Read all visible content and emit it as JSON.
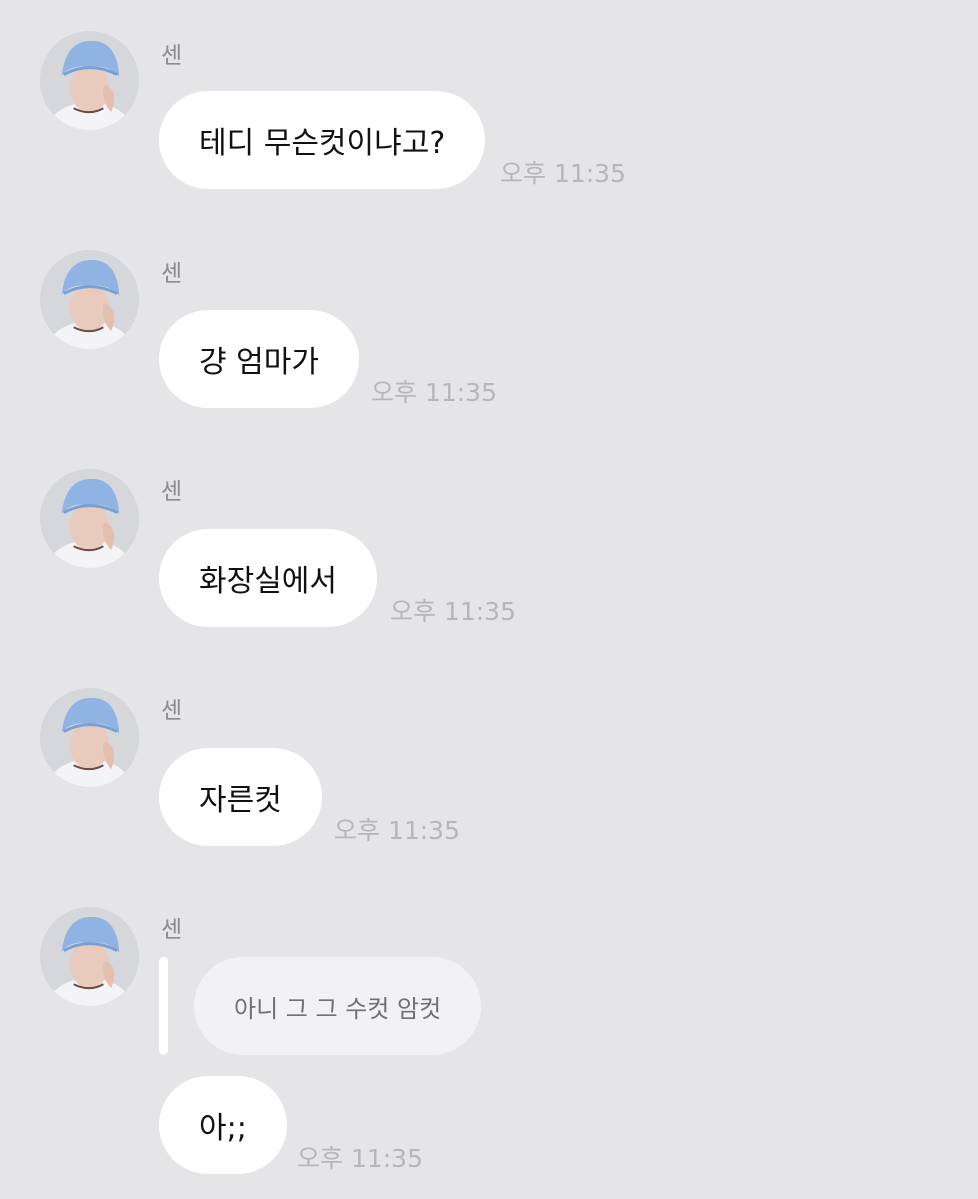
{
  "messages": [
    {
      "sender": "센",
      "text": "테디 무슨컷이냐고?",
      "time": "오후 11:35"
    },
    {
      "sender": "센",
      "text": "걍 엄마가",
      "time": "오후 11:35"
    },
    {
      "sender": "센",
      "text": "화장실에서",
      "time": "오후 11:35"
    },
    {
      "sender": "센",
      "text": "자른컷",
      "time": "오후 11:35"
    },
    {
      "sender": "센",
      "quoted_text": "아니 그 그 수컷 암컷",
      "text": "아;;",
      "time": "오후 11:35"
    }
  ],
  "colors": {
    "background": "#e5e5e7",
    "bubble": "#ffffff",
    "quote_bubble": "#f2f2f4",
    "time_text": "#b6b6bb",
    "sender_text": "#8b8b90",
    "avatar_hat": "#8fb3e3"
  }
}
